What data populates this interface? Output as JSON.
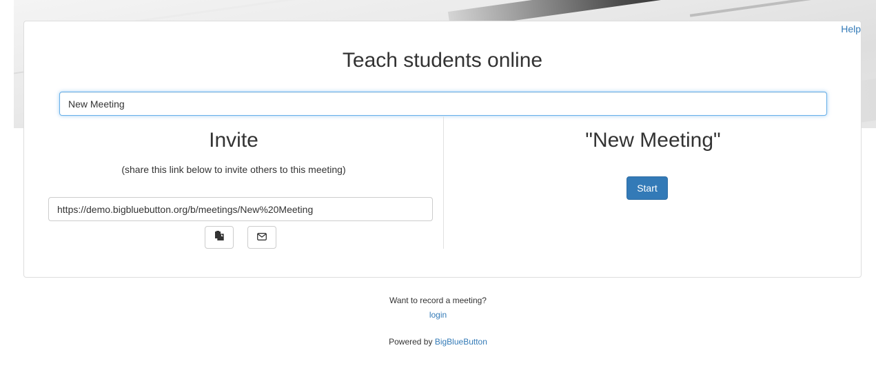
{
  "help": {
    "label": "Help"
  },
  "card": {
    "title": "Teach students online",
    "meeting_input": {
      "value": "New Meeting"
    }
  },
  "invite": {
    "title": "Invite",
    "subtitle": "(share this link below to invite others to this meeting)",
    "link_value": "https://demo.bigbluebutton.org/b/meetings/New%20Meeting",
    "copy_icon": "clipboard-icon",
    "email_icon": "envelope-icon"
  },
  "meeting": {
    "name": "\"New Meeting\"",
    "start_label": "Start"
  },
  "footer": {
    "record_question": "Want to record a meeting?",
    "login_label": "login",
    "powered_prefix": "Powered by",
    "powered_link": "BigBlueButton"
  },
  "colors": {
    "link": "#337ab7",
    "primary_button": "#337ab7",
    "focus_border": "#66afe9"
  }
}
